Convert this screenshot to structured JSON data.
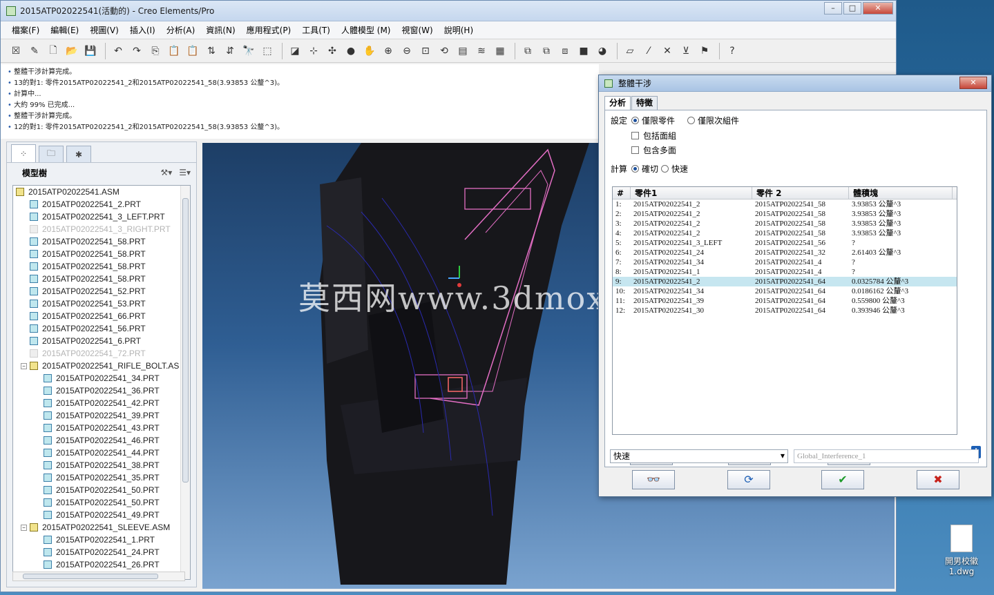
{
  "window": {
    "title": "2015ATP02022541(活動的) - Creo Elements/Pro"
  },
  "menu": [
    "檔案(F)",
    "編輯(E)",
    "視圖(V)",
    "插入(I)",
    "分析(A)",
    "資訊(N)",
    "應用程式(P)",
    "工具(T)",
    "人體模型 (M)",
    "視窗(W)",
    "說明(H)"
  ],
  "messages": [
    "整體干涉計算完成。",
    "13的對1: 零件2015ATP02022541_2和2015ATP02022541_58(3.93853 公釐^3)。",
    "計算中...",
    "大約 99% 已完成...",
    "整體干涉計算完成。",
    "12的對1: 零件2015ATP02022541_2和2015ATP02022541_58(3.93853 公釐^3)。"
  ],
  "tree": {
    "header": "模型樹",
    "items": [
      {
        "label": "2015ATP02022541.ASM",
        "indent": 0,
        "type": "asm"
      },
      {
        "label": "2015ATP02022541_2.PRT",
        "indent": 1,
        "type": "prt"
      },
      {
        "label": "2015ATP02022541_3_LEFT.PRT",
        "indent": 1,
        "type": "prt"
      },
      {
        "label": "2015ATP02022541_3_RIGHT.PRT",
        "indent": 1,
        "type": "dim"
      },
      {
        "label": "2015ATP02022541_58.PRT",
        "indent": 1,
        "type": "prt"
      },
      {
        "label": "2015ATP02022541_58.PRT",
        "indent": 1,
        "type": "prt"
      },
      {
        "label": "2015ATP02022541_58.PRT",
        "indent": 1,
        "type": "prt"
      },
      {
        "label": "2015ATP02022541_58.PRT",
        "indent": 1,
        "type": "prt"
      },
      {
        "label": "2015ATP02022541_52.PRT",
        "indent": 1,
        "type": "prt"
      },
      {
        "label": "2015ATP02022541_53.PRT",
        "indent": 1,
        "type": "prt"
      },
      {
        "label": "2015ATP02022541_66.PRT",
        "indent": 1,
        "type": "prt"
      },
      {
        "label": "2015ATP02022541_56.PRT",
        "indent": 1,
        "type": "prt"
      },
      {
        "label": "2015ATP02022541_6.PRT",
        "indent": 1,
        "type": "prt"
      },
      {
        "label": "2015ATP02022541_72.PRT",
        "indent": 1,
        "type": "dim"
      },
      {
        "label": "2015ATP02022541_RIFLE_BOLT.AS",
        "indent": 1,
        "type": "asm",
        "expander": "−"
      },
      {
        "label": "2015ATP02022541_34.PRT",
        "indent": 2,
        "type": "prt"
      },
      {
        "label": "2015ATP02022541_36.PRT",
        "indent": 2,
        "type": "prt"
      },
      {
        "label": "2015ATP02022541_42.PRT",
        "indent": 2,
        "type": "prt"
      },
      {
        "label": "2015ATP02022541_39.PRT",
        "indent": 2,
        "type": "prt"
      },
      {
        "label": "2015ATP02022541_43.PRT",
        "indent": 2,
        "type": "prt"
      },
      {
        "label": "2015ATP02022541_46.PRT",
        "indent": 2,
        "type": "prt"
      },
      {
        "label": "2015ATP02022541_44.PRT",
        "indent": 2,
        "type": "prt"
      },
      {
        "label": "2015ATP02022541_38.PRT",
        "indent": 2,
        "type": "prt"
      },
      {
        "label": "2015ATP02022541_35.PRT",
        "indent": 2,
        "type": "prt"
      },
      {
        "label": "2015ATP02022541_50.PRT",
        "indent": 2,
        "type": "prt"
      },
      {
        "label": "2015ATP02022541_50.PRT",
        "indent": 2,
        "type": "prt"
      },
      {
        "label": "2015ATP02022541_49.PRT",
        "indent": 2,
        "type": "prt"
      },
      {
        "label": "2015ATP02022541_SLEEVE.ASM",
        "indent": 1,
        "type": "asm",
        "expander": "−"
      },
      {
        "label": "2015ATP02022541_1.PRT",
        "indent": 2,
        "type": "prt"
      },
      {
        "label": "2015ATP02022541_24.PRT",
        "indent": 2,
        "type": "prt"
      },
      {
        "label": "2015ATP02022541_26.PRT",
        "indent": 2,
        "type": "prt"
      }
    ]
  },
  "watermark": "莫西网www.3dmoxi.com",
  "dialog": {
    "title": "整體干涉",
    "tabs": [
      "分析",
      "特徵"
    ],
    "setting_label": "設定",
    "opt_parts_only": "僅限零件",
    "opt_subasm_only": "僅限次組件",
    "opt_include_quilts": "包括面組",
    "opt_include_facets": "包含多面",
    "calc_label": "計算",
    "opt_exact": "確切",
    "opt_quick": "快速",
    "columns": [
      "#",
      "零件1",
      "零件 2",
      "體積塊"
    ],
    "rows": [
      [
        "1:",
        "2015ATP02022541_2",
        "2015ATP02022541_58",
        "3.93853 公釐^3"
      ],
      [
        "2:",
        "2015ATP02022541_2",
        "2015ATP02022541_58",
        "3.93853 公釐^3"
      ],
      [
        "3:",
        "2015ATP02022541_2",
        "2015ATP02022541_58",
        "3.93853 公釐^3"
      ],
      [
        "4:",
        "2015ATP02022541_2",
        "2015ATP02022541_58",
        "3.93853 公釐^3"
      ],
      [
        "5:",
        "2015ATP02022541_3_LEFT",
        "2015ATP02022541_56",
        "?"
      ],
      [
        "6:",
        "2015ATP02022541_24",
        "2015ATP02022541_32",
        "2.61403 公釐^3"
      ],
      [
        "7:",
        "2015ATP02022541_34",
        "2015ATP02022541_4",
        "?"
      ],
      [
        "8:",
        "2015ATP02022541_1",
        "2015ATP02022541_4",
        "?"
      ],
      [
        "9:",
        "2015ATP02022541_2",
        "2015ATP02022541_64",
        "0.0325784 公釐^3"
      ],
      [
        "10:",
        "2015ATP02022541_34",
        "2015ATP02022541_64",
        "0.0186162 公釐^3"
      ],
      [
        "11:",
        "2015ATP02022541_39",
        "2015ATP02022541_64",
        "0.559800 公釐^3"
      ],
      [
        "12:",
        "2015ATP02022541_30",
        "2015ATP02022541_64",
        "0.393946 公釐^3"
      ]
    ],
    "selected_row": 8,
    "btn_show_all": "顯示全部",
    "btn_clear": "清除",
    "btn_check": "核對",
    "mode_value": "快速",
    "name_placeholder": "Global_Interference_1"
  },
  "desktop": {
    "file_label": "開男校徽\n1.dwg"
  }
}
